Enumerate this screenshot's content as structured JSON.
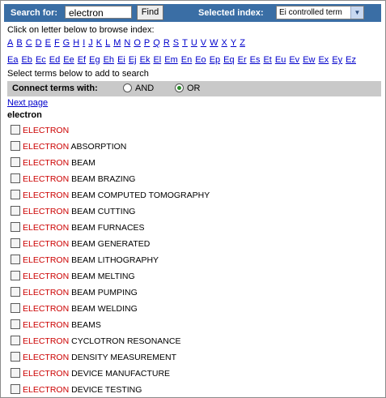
{
  "search": {
    "label": "Search for:",
    "value": "electron",
    "find_label": "Find"
  },
  "index": {
    "label": "Selected index:",
    "selected": "Ei controlled term"
  },
  "browse_text": "Click on letter below to browse index:",
  "letters": [
    "A",
    "B",
    "C",
    "D",
    "E",
    "F",
    "G",
    "H",
    "I",
    "J",
    "K",
    "L",
    "M",
    "N",
    "O",
    "P",
    "Q",
    "R",
    "S",
    "T",
    "U",
    "V",
    "W",
    "X",
    "Y",
    "Z"
  ],
  "codes": [
    "Ea",
    "Eb",
    "Ec",
    "Ed",
    "Ee",
    "Ef",
    "Eg",
    "Eh",
    "Ei",
    "Ej",
    "Ek",
    "El",
    "Em",
    "En",
    "Eo",
    "Ep",
    "Eq",
    "Er",
    "Es",
    "Et",
    "Eu",
    "Ev",
    "Ew",
    "Ex",
    "Ey",
    "Ez"
  ],
  "select_text": "Select terms below to add to search",
  "connect": {
    "label": "Connect terms with:",
    "and_label": "AND",
    "or_label": "OR",
    "selected": "OR"
  },
  "next_page": "Next page",
  "term_heading": "electron",
  "highlight": "ELECTRON",
  "terms": [
    "",
    " ABSORPTION",
    " BEAM",
    " BEAM BRAZING",
    " BEAM COMPUTED TOMOGRAPHY",
    " BEAM CUTTING",
    " BEAM FURNACES",
    " BEAM GENERATED",
    " BEAM LITHOGRAPHY",
    " BEAM MELTING",
    " BEAM PUMPING",
    " BEAM WELDING",
    " BEAMS",
    " CYCLOTRON RESONANCE",
    " DENSITY MEASUREMENT",
    " DEVICE MANUFACTURE",
    " DEVICE TESTING"
  ],
  "colors": {
    "header_bar": "#3a6ea5",
    "connect_bar": "#c9c9c9",
    "highlight": "#cc0000",
    "link": "#0000cc"
  },
  "icons": {
    "dropdown": "chevron-down-icon",
    "checkbox": "checkbox-icon",
    "radio": "radio-icon"
  }
}
